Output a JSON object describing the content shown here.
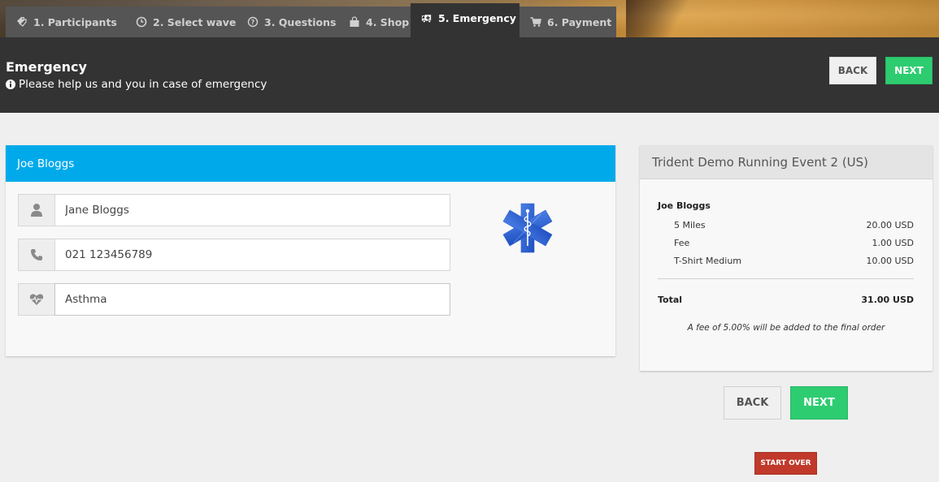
{
  "tabs": [
    {
      "label": "1. Participants",
      "icon": "tag-icon",
      "active": false
    },
    {
      "label": "2. Select wave",
      "icon": "clock-icon",
      "active": false
    },
    {
      "label": "3. Questions",
      "icon": "question-circle-icon",
      "active": false
    },
    {
      "label": "4. Shop",
      "icon": "shopping-bag-icon",
      "active": false
    },
    {
      "label": "5. Emergency",
      "icon": "ambulance-icon",
      "active": true
    },
    {
      "label": "6. Payment",
      "icon": "cart-icon",
      "active": false
    }
  ],
  "header": {
    "title": "Emergency",
    "subtitle": "Please help us and you in case of emergency",
    "subtitle_icon": "info-circle-icon",
    "back_label": "BACK",
    "next_label": "NEXT"
  },
  "participant": {
    "name": "Joe Bloggs",
    "fields": [
      {
        "name": "emergency-contact-name",
        "icon": "user-icon",
        "value": "Jane Bloggs"
      },
      {
        "name": "emergency-contact-phone",
        "icon": "phone-icon",
        "value": "021 123456789"
      },
      {
        "name": "medical-condition",
        "icon": "heartbeat-icon",
        "value": "Asthma"
      }
    ],
    "illustration": "star-of-life-icon"
  },
  "summary": {
    "event_title": "Trident Demo Running Event 2 (US)",
    "participant": "Joe Bloggs",
    "items": [
      {
        "label": "5 Miles",
        "amount": "20.00 USD"
      },
      {
        "label": "Fee",
        "amount": "1.00 USD"
      },
      {
        "label": "T-Shirt Medium",
        "amount": "10.00 USD"
      }
    ],
    "total_label": "Total",
    "total_amount": "31.00 USD",
    "fee_note": "A fee of 5.00% will be added to the final order"
  },
  "actions": {
    "back_label": "BACK",
    "next_label": "NEXT",
    "start_over_label": "START OVER"
  },
  "colors": {
    "accent_blue": "#00aaea",
    "next_green": "#2ecc71",
    "start_over_red": "#c0392b",
    "header_dark": "#333333"
  }
}
